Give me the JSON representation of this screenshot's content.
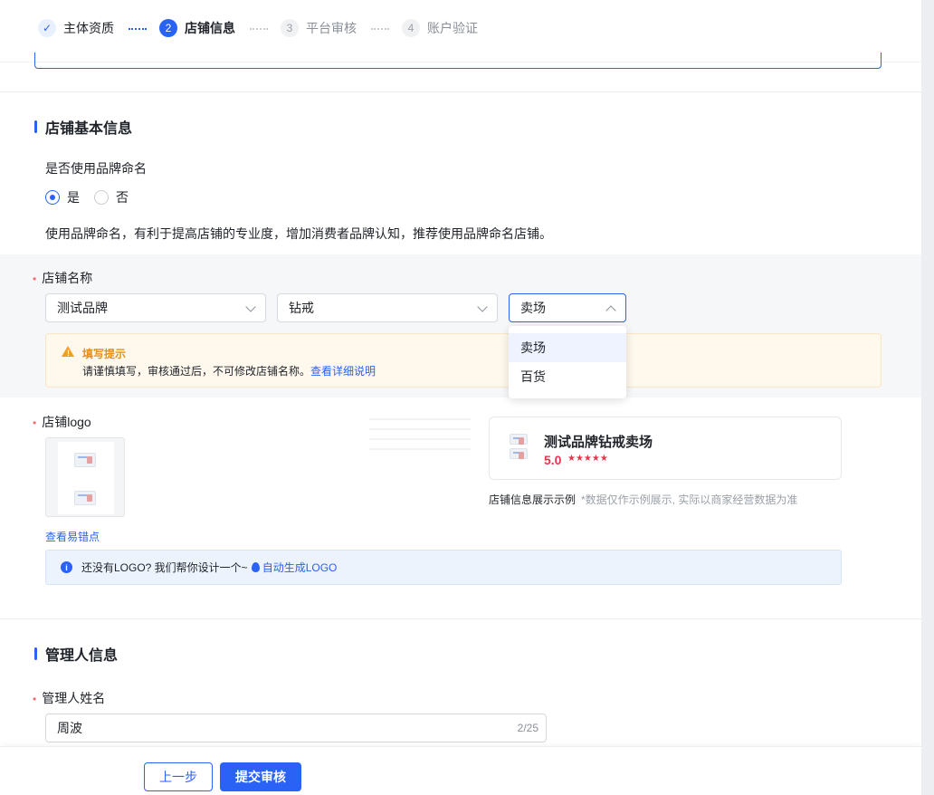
{
  "stepper": {
    "steps": [
      {
        "num": "✓",
        "label": "主体资质"
      },
      {
        "num": "2",
        "label": "店铺信息"
      },
      {
        "num": "3",
        "label": "平台审核"
      },
      {
        "num": "4",
        "label": "账户验证"
      }
    ]
  },
  "basic_section": {
    "title": "店铺基本信息",
    "brand_question": "是否使用品牌命名",
    "radio_yes": "是",
    "radio_no": "否",
    "selected": "是",
    "hint": "使用品牌命名，有利于提高店铺的专业度，增加消费者品牌认知，推荐使用品牌命名店铺。"
  },
  "shop_name": {
    "required_mark": "•",
    "label": "店铺名称",
    "select1": "测试品牌",
    "select2": "钻戒",
    "select3": "卖场",
    "dropdown_options": [
      "卖场",
      "百货"
    ],
    "warning_title": "填写提示",
    "warning_body": "请谨慎填写，审核通过后，不可修改店铺名称。",
    "warning_link": "查看详细说明"
  },
  "shop_logo": {
    "label": "店铺logo",
    "error_link": "查看易错点",
    "info_text": "还没有LOGO? 我们帮你设计一个~",
    "info_link": "自动生成LOGO"
  },
  "preview": {
    "shop_name": "测试品牌钻戒卖场",
    "score": "5.0",
    "stars": "★★★★★",
    "caption": "店铺信息展示示例",
    "caption_note": "*数据仅作示例展示, 实际以商家经营数据为准"
  },
  "manager_section": {
    "title": "管理人信息",
    "name_label": "管理人姓名",
    "name_value": "周波",
    "name_count": "2/25"
  },
  "footer": {
    "prev_label": "上一步",
    "submit_label": "提交审核"
  },
  "colors": {
    "primary": "#2a62f5",
    "warning": "#f0a020",
    "rating": "#e8344e"
  }
}
